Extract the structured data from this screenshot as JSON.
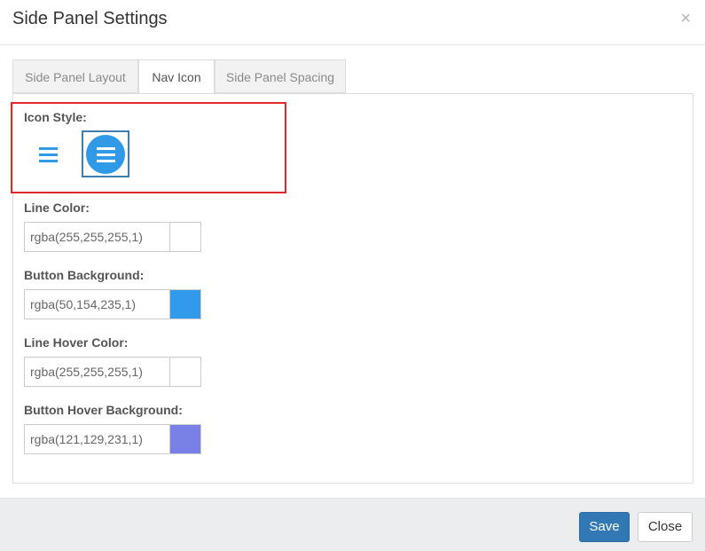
{
  "dialog": {
    "title": "Side Panel Settings",
    "close_glyph": "×"
  },
  "tabs": [
    {
      "label": "Side Panel Layout",
      "active": false
    },
    {
      "label": "Nav Icon",
      "active": true
    },
    {
      "label": "Side Panel Spacing",
      "active": false
    }
  ],
  "icon_style": {
    "label": "Icon Style:",
    "options": [
      {
        "name": "hamburger-plain-icon",
        "selected": false
      },
      {
        "name": "hamburger-circle-icon",
        "selected": true
      }
    ]
  },
  "fields": [
    {
      "label": "Line Color:",
      "value": "rgba(255,255,255,1)",
      "swatch": "#ffffff"
    },
    {
      "label": "Button Background:",
      "value": "rgba(50,154,235,1)",
      "swatch": "#329aeb"
    },
    {
      "label": "Line Hover Color:",
      "value": "rgba(255,255,255,1)",
      "swatch": "#ffffff"
    },
    {
      "label": "Button Hover Background:",
      "value": "rgba(121,129,231,1)",
      "swatch": "#7981e7"
    }
  ],
  "footer": {
    "save_label": "Save",
    "close_label": "Close"
  },
  "colors": {
    "accent": "#319ae8",
    "primary_button": "#3278b5",
    "highlight_border": "#e0292b"
  }
}
